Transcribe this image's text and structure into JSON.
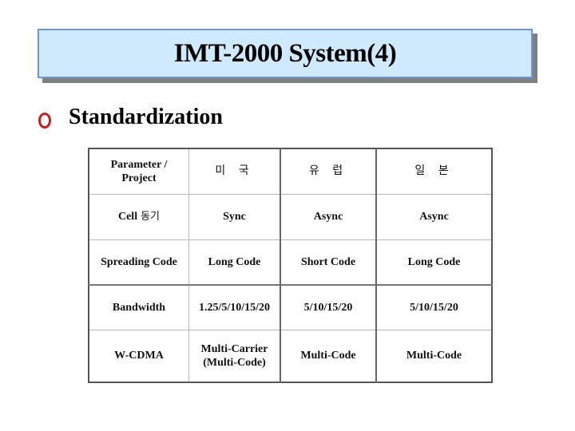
{
  "slide": {
    "title": "IMT-2000 System(4)",
    "bullet_icon": "red-ring-bullet-icon",
    "colors": {
      "title_fill": "#cfeafc",
      "title_border": "#6f93d8",
      "title_shadow": "#7f7f7f",
      "bullet": "#d01a1a"
    },
    "heading": "Standardization"
  },
  "table": {
    "header": {
      "parameter_line1": "Parameter /",
      "parameter_line2": "Project",
      "usa": "미 국",
      "europe": "유 럽",
      "japan": "일 본"
    },
    "rows": [
      {
        "param": "Cell",
        "param_kr": "동기",
        "usa": "Sync",
        "europe": "Async",
        "japan": "Async"
      },
      {
        "param": "Spreading Code",
        "usa": "Long Code",
        "europe": "Short Code",
        "japan": "Long Code"
      },
      {
        "param": "Bandwidth",
        "usa": "1.25/5/10/15/20",
        "europe": "5/10/15/20",
        "japan": "5/10/15/20"
      },
      {
        "param": "W-CDMA",
        "usa_line1": "Multi-Carrier",
        "usa_line2": "(Multi-Code)",
        "europe": "Multi-Code",
        "japan": "Multi-Code"
      }
    ]
  }
}
